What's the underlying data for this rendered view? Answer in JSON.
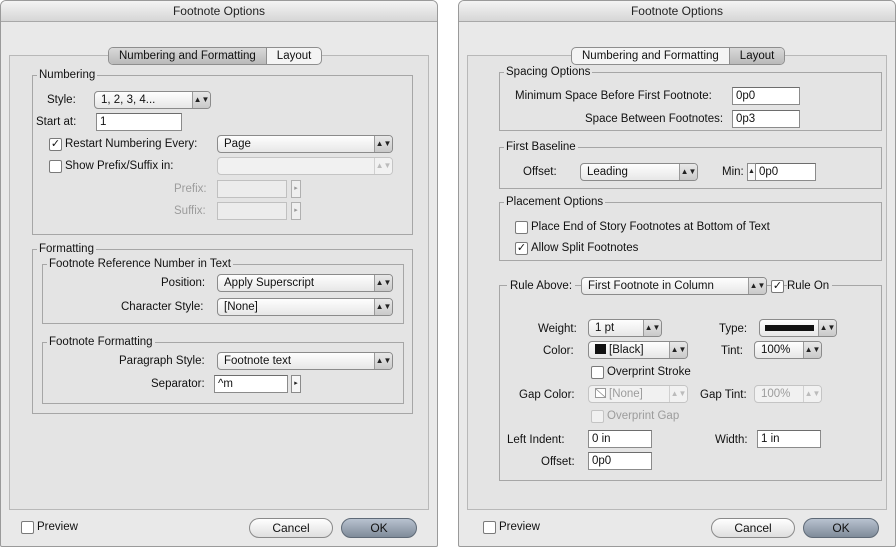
{
  "left": {
    "title": "Footnote Options",
    "tabs": [
      "Numbering and Formatting",
      "Layout"
    ],
    "numbering": {
      "legend": "Numbering",
      "style_label": "Style:",
      "style_value": "1, 2, 3, 4...",
      "start_label": "Start at:",
      "start_value": "1",
      "restart_label": "Restart Numbering Every:",
      "restart_value": "Page",
      "prefix_suffix_label": "Show Prefix/Suffix in:",
      "prefix_label": "Prefix:",
      "suffix_label": "Suffix:"
    },
    "formatting": {
      "legend": "Formatting",
      "ref_legend": "Footnote Reference Number in Text",
      "position_label": "Position:",
      "position_value": "Apply Superscript",
      "char_style_label": "Character Style:",
      "char_style_value": "[None]",
      "ff_legend": "Footnote Formatting",
      "para_style_label": "Paragraph Style:",
      "para_style_value": "Footnote text",
      "separator_label": "Separator:",
      "separator_value": "^m"
    },
    "preview": "Preview",
    "cancel": "Cancel",
    "ok": "OK"
  },
  "right": {
    "title": "Footnote Options",
    "tabs": [
      "Numbering and Formatting",
      "Layout"
    ],
    "spacing": {
      "legend": "Spacing Options",
      "min_space_label": "Minimum Space Before First Footnote:",
      "min_space_value": "0p0",
      "between_label": "Space Between Footnotes:",
      "between_value": "0p3"
    },
    "baseline": {
      "legend": "First Baseline",
      "offset_label": "Offset:",
      "offset_value": "Leading",
      "min_label": "Min:",
      "min_value": "0p0"
    },
    "placement": {
      "legend": "Placement Options",
      "end_story_label": "Place End of Story Footnotes at Bottom of Text",
      "allow_split_label": "Allow Split Footnotes"
    },
    "rule": {
      "rule_above_label": "Rule Above:",
      "rule_above_value": "First Footnote in Column",
      "rule_on_label": "Rule On",
      "weight_label": "Weight:",
      "weight_value": "1 pt",
      "type_label": "Type:",
      "color_label": "Color:",
      "color_value": "[Black]",
      "tint_label": "Tint:",
      "tint_value": "100%",
      "overprint_stroke_label": "Overprint Stroke",
      "gap_color_label": "Gap Color:",
      "gap_color_value": "[None]",
      "gap_tint_label": "Gap Tint:",
      "gap_tint_value": "100%",
      "overprint_gap_label": "Overprint Gap",
      "left_indent_label": "Left Indent:",
      "left_indent_value": "0 in",
      "width_label": "Width:",
      "width_value": "1 in",
      "offset_label": "Offset:",
      "offset_value": "0p0"
    },
    "preview": "Preview",
    "cancel": "Cancel",
    "ok": "OK"
  }
}
